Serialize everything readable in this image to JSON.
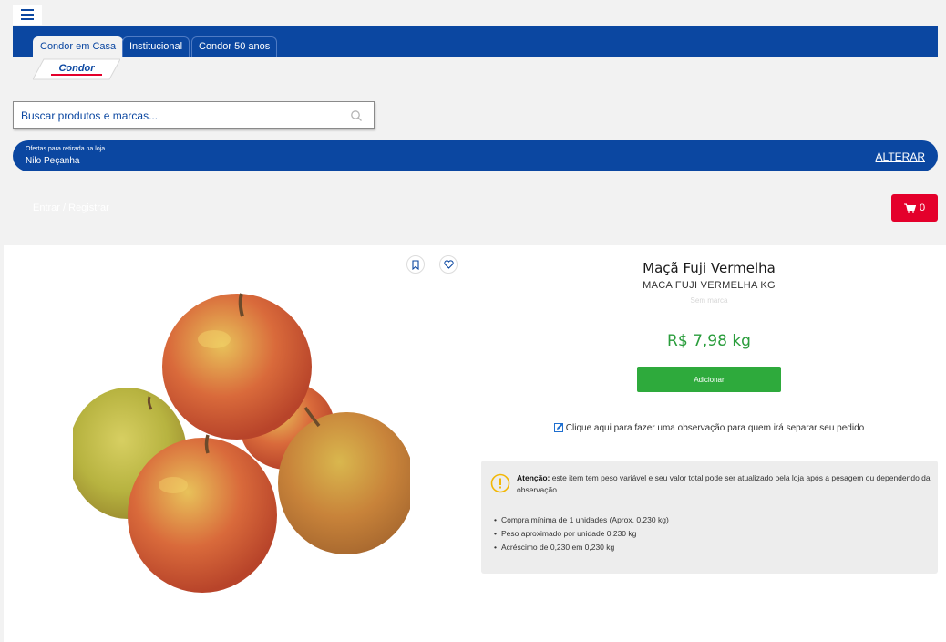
{
  "header": {
    "tabs": [
      {
        "label": "Condor em Casa",
        "active": true
      },
      {
        "label": "Institucional",
        "active": false
      },
      {
        "label": "Condor 50 anos",
        "active": false
      }
    ],
    "logo_text": "Condor"
  },
  "search": {
    "placeholder": "Buscar produtos e marcas..."
  },
  "store": {
    "label": "Ofertas para retirada na loja",
    "name": "Nilo Peçanha",
    "change_label": "ALTERAR"
  },
  "account": {
    "login_label": "Entrar / Registrar"
  },
  "cart": {
    "count": "0"
  },
  "product": {
    "title": "Maçã Fuji Vermelha",
    "subtitle": "MACA FUJI VERMELHA KG",
    "brand": "Sem marca",
    "price": "R$ 7,98 kg",
    "add_label": "Adicionar",
    "observation_link": "Clique aqui para fazer uma observação para quem irá separar seu pedido",
    "notice": {
      "strong": "Atenção:",
      "text": " este item tem peso variável e seu valor total pode ser atualizado pela loja após a pesagem ou dependendo da observação.",
      "items": [
        "Compra mínima de 1 unidades (Aprox. 0,230 kg)",
        "Peso aproximado por unidade 0,230 kg",
        "Acréscimo de 0,230 em 0,230 kg"
      ]
    }
  },
  "colors": {
    "brand_blue": "#0b47a1",
    "price_green": "#2a9d3c",
    "cart_red": "#e4002b"
  },
  "icons": [
    "menu-icon",
    "search-icon",
    "cart-icon",
    "bookmark-icon",
    "heart-icon",
    "pencil-icon",
    "warning-icon"
  ]
}
